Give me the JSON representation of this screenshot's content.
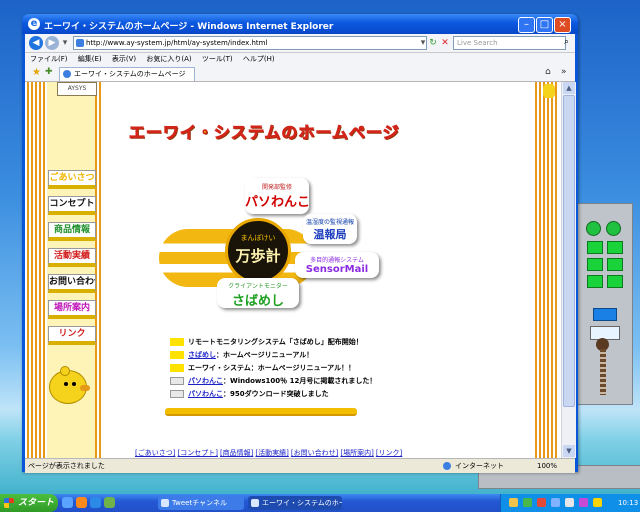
{
  "window": {
    "title": "エーワイ・システムのホームページ - Windows Internet Explorer",
    "address": "http://www.ay-system.jp/html/ay-system/index.html",
    "search_placeholder": "Live Search",
    "menus": [
      "ファイル(F)",
      "編集(E)",
      "表示(V)",
      "お気に入り(A)",
      "ツール(T)",
      "ヘルプ(H)"
    ],
    "tab_label": "エーワイ・システムのホームページ",
    "status": "ページが表示されました",
    "zone": "インターネット",
    "zoom": "100%"
  },
  "page": {
    "logo_text": "AYSYS",
    "headline": "エーワイ・システムのホームページ",
    "nav": [
      "ごあいさつ",
      "コンセプト",
      "商品情報",
      "活動実績",
      "お問い合わせ",
      "場所案内",
      "リンク"
    ],
    "nav_colors": [
      "#f2b600",
      "#111111",
      "#1e8f2a",
      "#d21d1d",
      "#111111",
      "#c018b8",
      "#d21d1d"
    ],
    "product_center": {
      "ruby": "まんぽけい",
      "title": "万歩計"
    },
    "product_pasowanko": {
      "small": "開発部監修",
      "big": "パソわんこ"
    },
    "product_ondoken": {
      "small": "温湿度の監視通報",
      "big": "温報局"
    },
    "product_sensormail": {
      "small": "多目的通報システム",
      "big": "SensorMail"
    },
    "product_sabameshi": {
      "small": "クライアントモニター",
      "big": "さばめし"
    },
    "news": [
      {
        "link": "",
        "text": "リモートモニタリングシステム「さばめし」配布開始！"
      },
      {
        "link": "さばめし",
        "text": "：ホームページリニューアル！"
      },
      {
        "link": "",
        "text": "エーワイ・システム：ホームページリニューアル！！"
      },
      {
        "link": "パソわんこ",
        "text": "：Windows100％ 12月号に掲載されました！"
      },
      {
        "link": "パソわんこ",
        "text": "：950ダウンロード突破しました"
      }
    ],
    "footer_links": [
      "[ごあいさつ]",
      "[コンセプト]",
      "[商品情報]",
      "[活動実績]",
      "[お問い合わせ]",
      "[場所案内]",
      "[リンク]"
    ]
  },
  "taskbar": {
    "start": "スタート",
    "buttons": [
      "Tweetチャンネル",
      "エーワイ・システムのホー…"
    ],
    "clock": "10:13"
  }
}
